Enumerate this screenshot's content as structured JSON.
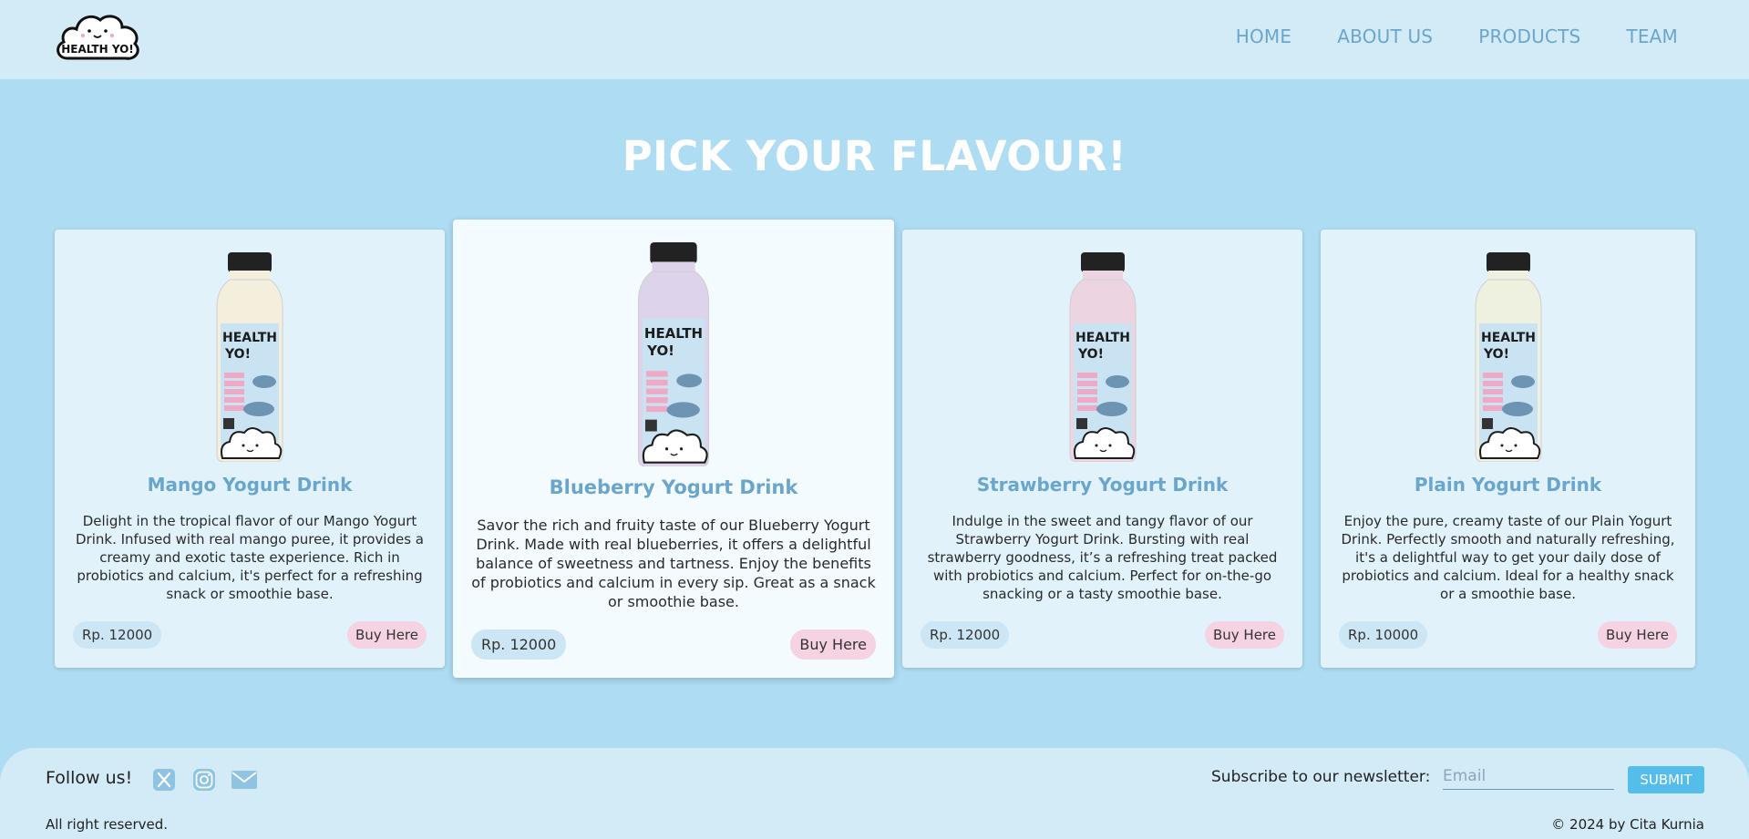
{
  "header": {
    "logo_text": "HEALTH YO!",
    "nav": [
      {
        "label": "HOME"
      },
      {
        "label": "ABOUT US"
      },
      {
        "label": "PRODUCTS"
      },
      {
        "label": "TEAM"
      }
    ]
  },
  "main": {
    "title": "PICK YOUR FLAVOUR!",
    "products": [
      {
        "name": "Mango Yogurt Drink",
        "description": "Delight in the tropical flavor of our Mango Yogurt Drink. Infused with real mango puree, it provides a creamy and exotic taste experience. Rich in probiotics and calcium, it's perfect for a refreshing snack or smoothie base.",
        "price": "Rp. 12000",
        "buy_label": "Buy Here",
        "bottle_color": "#f3efdc"
      },
      {
        "name": "Blueberry Yogurt Drink",
        "description": "Savor the rich and fruity taste of our Blueberry Yogurt Drink. Made with real blueberries, it offers a delightful balance of sweetness and tartness. Enjoy the benefits of probiotics and calcium in every sip. Great as a snack or smoothie base.",
        "price": "Rp. 12000",
        "buy_label": "Buy Here",
        "bottle_color": "#ddd3ea"
      },
      {
        "name": "Strawberry Yogurt Drink",
        "description": "Indulge in the sweet and tangy flavor of our Strawberry Yogurt Drink. Bursting with real strawberry goodness, it’s a refreshing treat packed with probiotics and calcium. Perfect for on-the-go snacking or a tasty smoothie base.",
        "price": "Rp. 12000",
        "buy_label": "Buy Here",
        "bottle_color": "#ecd5e0"
      },
      {
        "name": "Plain Yogurt Drink",
        "description": "Enjoy the pure, creamy taste of our Plain Yogurt Drink. Perfectly smooth and naturally refreshing, it's a delightful way to get your daily dose of probiotics and calcium. Ideal for a healthy snack or a smoothie base.",
        "price": "Rp. 10000",
        "buy_label": "Buy Here",
        "bottle_color": "#eef0e0"
      }
    ],
    "bottle_label": {
      "brand_line1": "HEALTH",
      "brand_line2": "YO!"
    }
  },
  "footer": {
    "follow_label": "Follow us!",
    "social_icons": [
      "x-icon",
      "instagram-icon",
      "mail-icon"
    ],
    "newsletter_label": "Subscribe to our newsletter:",
    "email_placeholder": "Email",
    "submit_label": "SUBMIT",
    "rights": "All right reserved.",
    "copyright": "© 2024 by Cita Kurnia"
  },
  "colors": {
    "page_bg": "#aedcf3",
    "header_bg": "#d2ebf7",
    "accent": "#6aa6cc",
    "price_pill": "#cde6f5",
    "buy_pill": "#f6d3e3",
    "submit": "#54bde9"
  }
}
